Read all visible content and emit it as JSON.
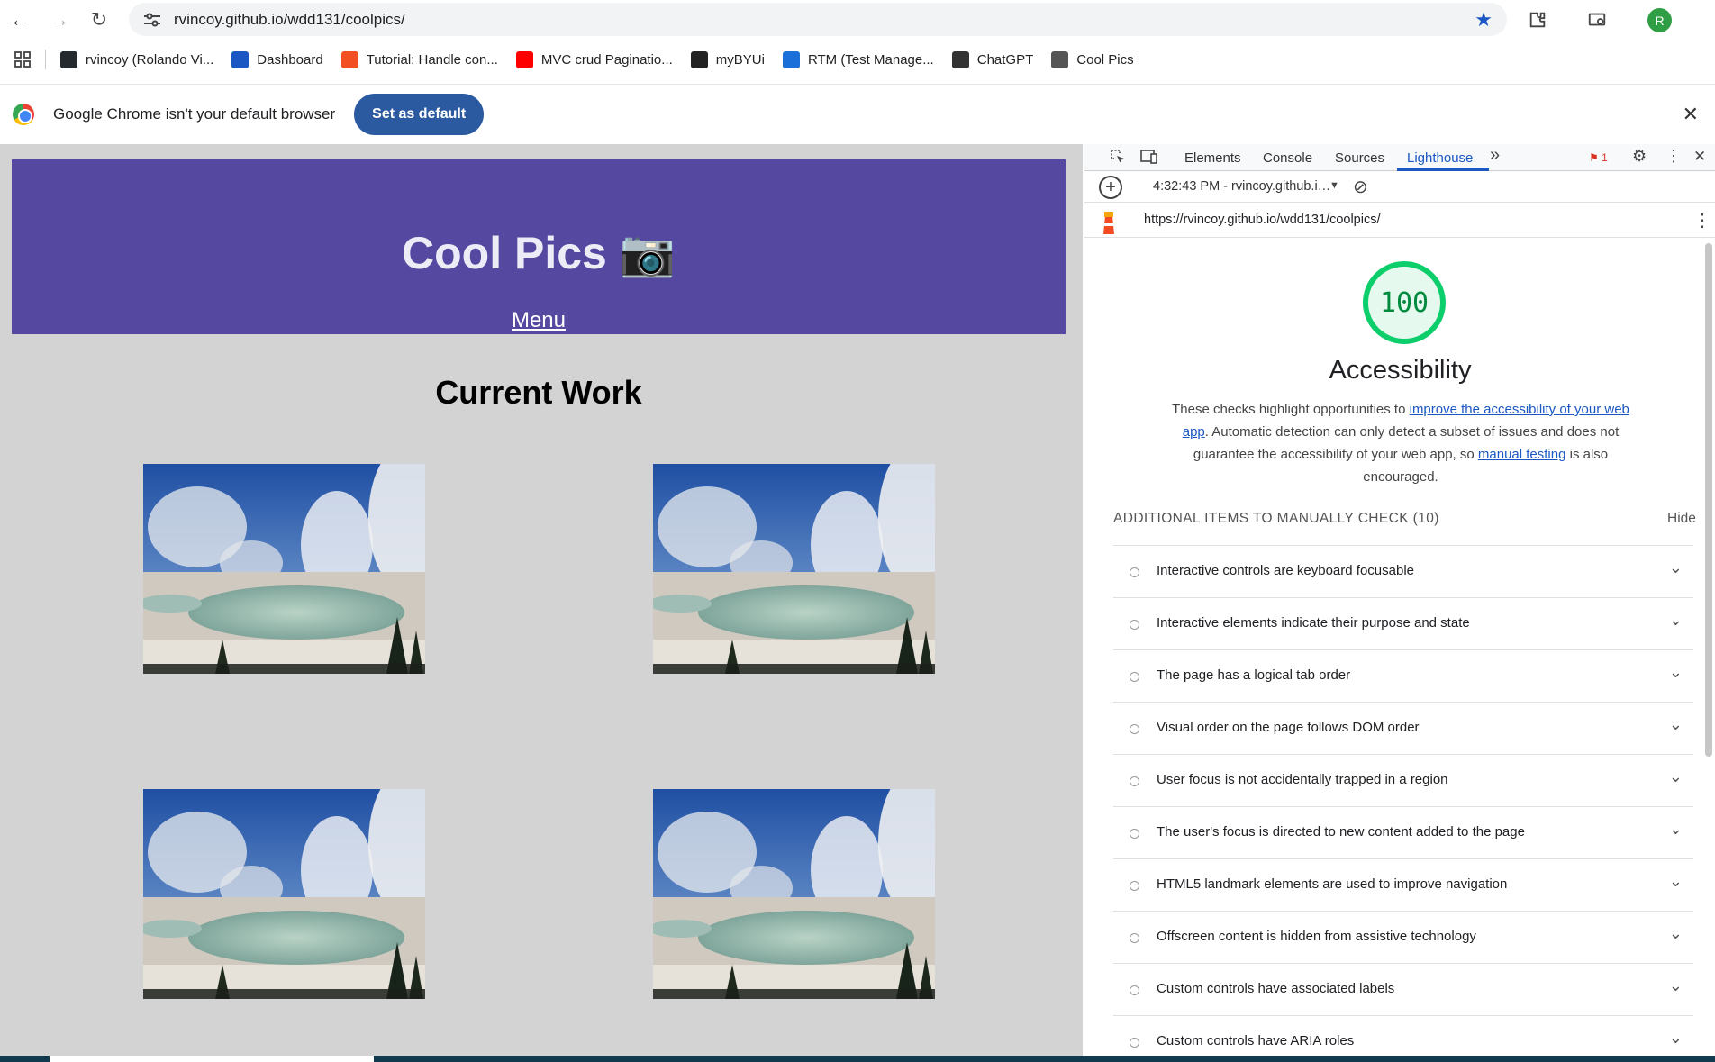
{
  "browser": {
    "url": "rvincoy.github.io/wdd131/coolpics/",
    "avatar_letter": "R",
    "accent": "#1a57c3"
  },
  "bookmarks": [
    {
      "label": "rvincoy (Rolando Vi...",
      "icon": "github-icon",
      "color": "#24292e"
    },
    {
      "label": "Dashboard",
      "icon": "dashboard-icon",
      "color": "#1a57c3"
    },
    {
      "label": "Tutorial: Handle con...",
      "icon": "microsoft-icon",
      "color": "#f25022"
    },
    {
      "label": "MVC crud Paginatio...",
      "icon": "youtube-icon",
      "color": "#ff0000"
    },
    {
      "label": "myBYUi",
      "icon": "byu-icon",
      "color": "#222"
    },
    {
      "label": "RTM (Test Manage...",
      "icon": "rtm-icon",
      "color": "#1a6fd8"
    },
    {
      "label": "ChatGPT",
      "icon": "chatgpt-icon",
      "color": "#333"
    },
    {
      "label": "Cool Pics",
      "icon": "globe-icon",
      "color": "#555"
    }
  ],
  "infobar": {
    "message": "Google Chrome isn't your default browser",
    "button": "Set as default"
  },
  "page": {
    "title": "Cool Pics 📷",
    "menu": "Menu",
    "section_heading": "Current Work",
    "header_color": "#5548a0",
    "background": "#d3d3d3"
  },
  "devtools": {
    "tabs": [
      "Elements",
      "Console",
      "Sources",
      "Lighthouse"
    ],
    "active_tab": "Lighthouse",
    "more_tabs": "»",
    "issues_count": "1",
    "report_select": "4:32:43 PM - rvincoy.github.i…",
    "report_url": "https://rvincoy.github.io/wdd131/coolpics/",
    "score": "100",
    "category": "Accessibility",
    "desc_1": "These checks highlight opportunities to ",
    "desc_link_1": "improve the accessibility of your web app",
    "desc_2": ". Automatic detection can only detect a subset of issues and does not guarantee the accessibility of your web app, so ",
    "desc_link_2": "manual testing",
    "desc_3": " is also encouraged.",
    "section_title": "ADDITIONAL ITEMS TO MANUALLY CHECK (10)",
    "hide_label": "Hide",
    "items": [
      "Interactive controls are keyboard focusable",
      "Interactive elements indicate their purpose and state",
      "The page has a logical tab order",
      "Visual order on the page follows DOM order",
      "User focus is not accidentally trapped in a region",
      "The user's focus is directed to new content added to the page",
      "HTML5 landmark elements are used to improve navigation",
      "Offscreen content is hidden from assistive technology",
      "Custom controls have associated labels",
      "Custom controls have ARIA roles"
    ],
    "score_color": "#0cce6b"
  }
}
